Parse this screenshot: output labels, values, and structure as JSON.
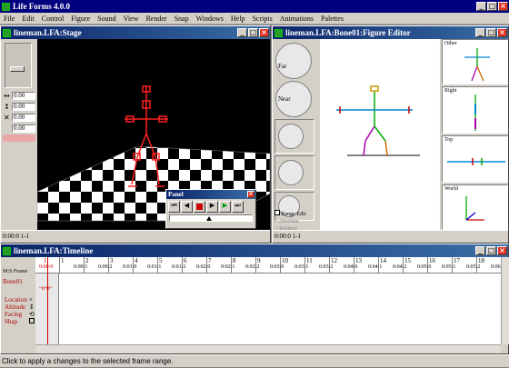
{
  "app": {
    "title": "Life Forms 4.0.0"
  },
  "menu": [
    "File",
    "Edit",
    "Control",
    "Figure",
    "Sound",
    "View",
    "Render",
    "Snap",
    "Windows",
    "Help",
    "Scripts",
    "Animations",
    "Palettes"
  ],
  "stage": {
    "title": "lineman.LFA:Stage",
    "fields": [
      "0.00",
      "0.00",
      "0.00",
      "0.00"
    ],
    "field_symbols": [
      "−",
      "↕",
      "✕"
    ],
    "status": "0:00:0 1-1"
  },
  "panel": {
    "title": "Panel"
  },
  "figure_editor": {
    "title": "lineman.LFA:Bone01:Figure Editor",
    "far_label": "Far",
    "near_label": "Near",
    "range_edit": "Range Edit",
    "absolute": "Absolute",
    "relative": "Relative",
    "views": [
      "Other",
      "Right",
      "Top",
      "World"
    ],
    "status": "0:00:0 1-1"
  },
  "timeline": {
    "title": "lineman.LFA:Timeline",
    "header": "M:S Frame",
    "figure": "Bone01",
    "cursor_frame": "1",
    "cursor_time": "0:00:0",
    "frames": [
      "1",
      "2",
      "3",
      "4",
      "5",
      "6",
      "7",
      "8",
      "9",
      "10",
      "11",
      "12",
      "13",
      "14",
      "15",
      "16",
      "17",
      "18",
      "19"
    ],
    "times": [
      "0:00:1",
      "0:00:2",
      "0:01:0",
      "0:01:1",
      "0:01:2",
      "0:02:0",
      "0:02:1",
      "0:02:2",
      "0:03:0",
      "0:03:1",
      "0:03:2",
      "0:04:0",
      "0:04:1",
      "0:04:2",
      "0:05:0",
      "0:05:1",
      "0:05:2",
      "0:06:0"
    ],
    "tracks": [
      "Location",
      "Altitude",
      "Facing",
      "Shap"
    ]
  },
  "status": "Click to apply a changes to the selected frame range.",
  "colors": {
    "stage_bg": "#000000",
    "figure": "#ff2020",
    "title_active": "#0a246a"
  }
}
